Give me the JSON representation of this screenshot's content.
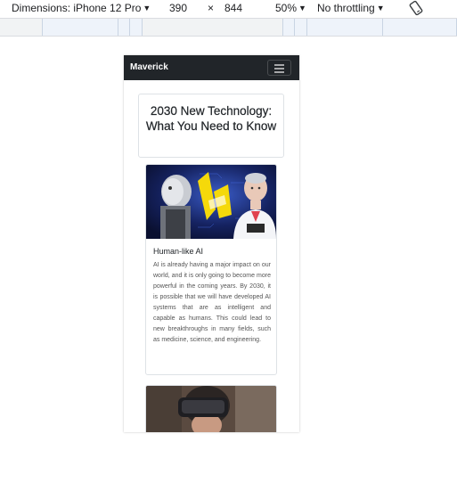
{
  "devtools": {
    "device_label": "Dimensions: iPhone 12 Pro",
    "width_value": "390",
    "times_symbol": "×",
    "height_value": "844",
    "zoom": "50%",
    "throttling": "No throttling",
    "icons": [
      "chevron-down-icon",
      "rotate-icon"
    ]
  },
  "site": {
    "brand": "Maverick",
    "page_title": "2030 New Technology: What You Need to Know",
    "cards": [
      {
        "title": "Human-like AI",
        "text": "AI is already having a major impact on our world, and it is only going to become more powerful in the coming years. By 2030, it is possible that we will have developed AI systems that are as intelligent and capable as humans. This could lead to new breakthroughs in many fields, such as medicine, science, and engineering.",
        "image_alt": "humanoid-robots-image"
      },
      {
        "title": "",
        "text": "",
        "image_alt": "vr-headset-image"
      }
    ]
  },
  "colors": {
    "navbar_bg": "#212529",
    "page_bg": "#ffffff",
    "devtools_ruler": "#f1f3f4"
  }
}
